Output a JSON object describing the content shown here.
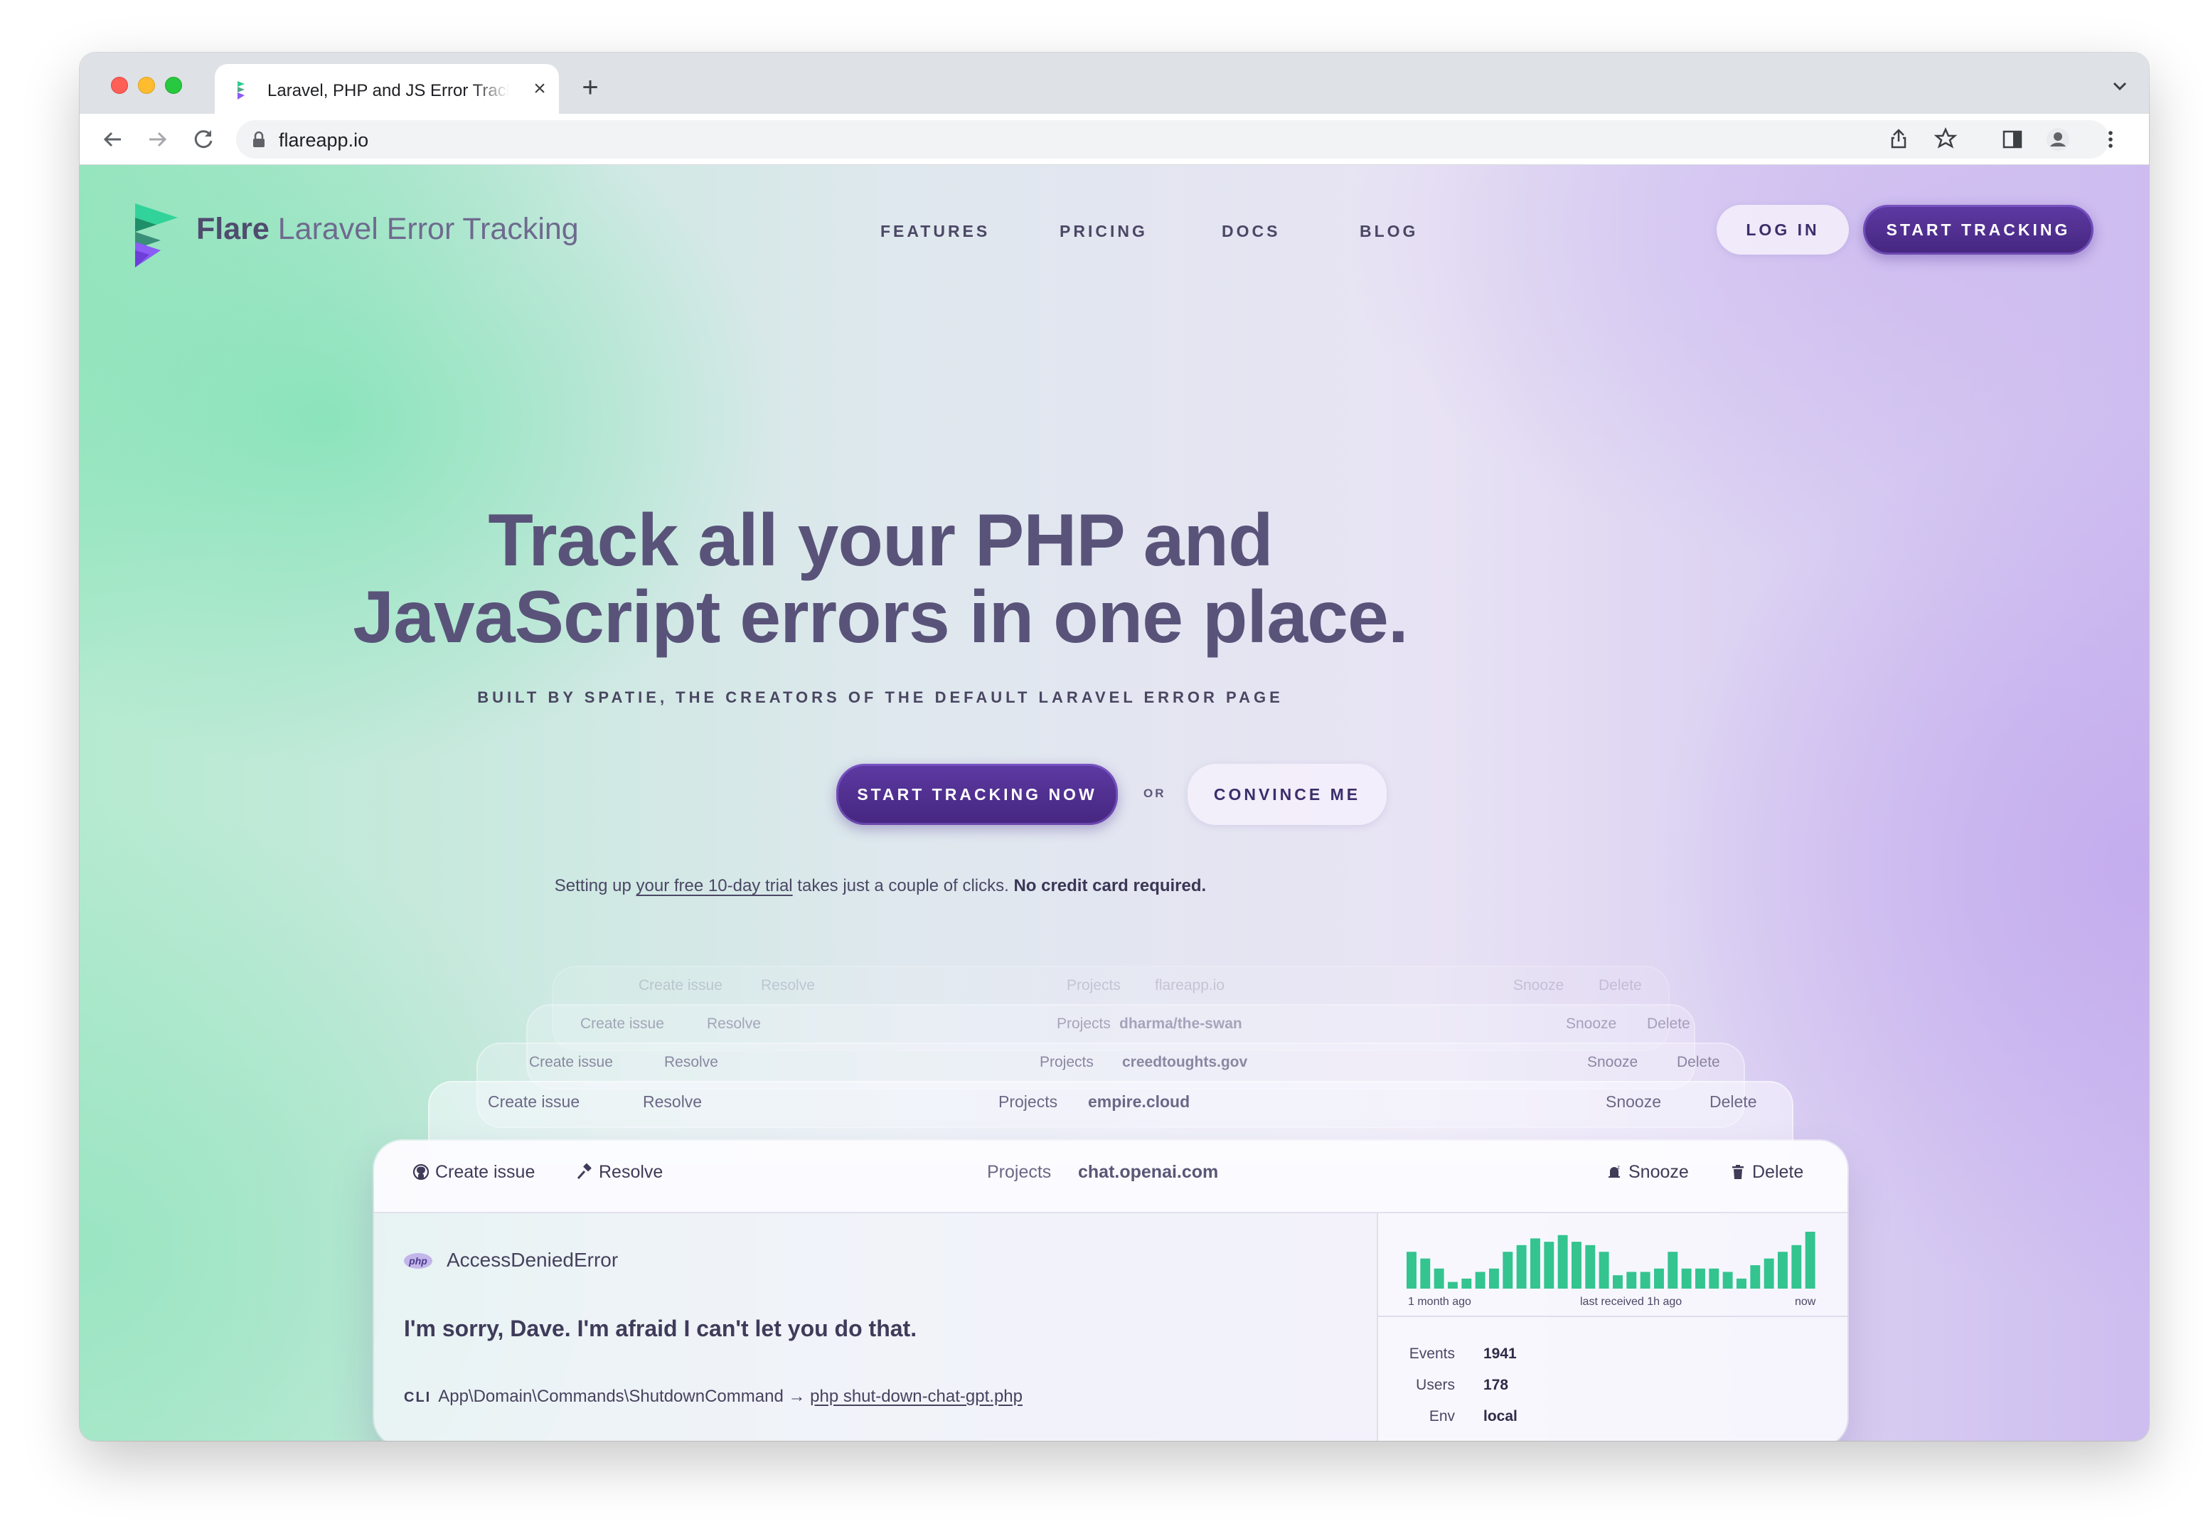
{
  "browser": {
    "tab_title": "Laravel, PHP and JS Error Tracking",
    "url": "flareapp.io",
    "colors": {
      "close_red": "#ff5f57",
      "minimize_yellow": "#febc2e",
      "zoom_green": "#28c840"
    }
  },
  "header": {
    "brand_name": "Flare",
    "brand_tagline": "Laravel Error Tracking",
    "nav": [
      "FEATURES",
      "PRICING",
      "DOCS",
      "BLOG"
    ],
    "login": "LOG IN",
    "start_tracking": "START TRACKING"
  },
  "hero": {
    "title_line1": "Track all your PHP and",
    "title_line2": "JavaScript errors in one place.",
    "subhead": "BUILT BY SPATIE, THE CREATORS OF THE DEFAULT LARAVEL ERROR PAGE",
    "cta_primary": "START TRACKING NOW",
    "or": "OR",
    "cta_secondary": "CONVINCE ME",
    "trial_before": "Setting up ",
    "trial_link": "your free 10-day trial",
    "trial_middle": " takes just a couple of clicks. ",
    "trial_bold": "No credit card required."
  },
  "stack": {
    "create_issue": "Create issue",
    "resolve": "Resolve",
    "projects": "Projects",
    "snooze": "Snooze",
    "delete": "Delete",
    "back_projects": [
      "flareapp.io",
      "dharma/the-swan",
      "creedtoughts.gov",
      "empire.cloud"
    ]
  },
  "card": {
    "project": "chat.openai.com",
    "php_badge": "php",
    "error_class": "AccessDeniedError",
    "error_message": "I'm sorry, Dave. I'm afraid I can't let you do that.",
    "cli_label": "CLI",
    "command": "App\\Domain\\Commands\\ShutdownCommand → ",
    "command_file": "php shut-down-chat-gpt.php",
    "chart_labels": {
      "left": "1 month ago",
      "middle": "last received 1h ago",
      "right": "now"
    },
    "stats": [
      {
        "key": "Events",
        "value": "1941"
      },
      {
        "key": "Users",
        "value": "178"
      },
      {
        "key": "Env",
        "value": "local"
      }
    ]
  },
  "chart_data": {
    "type": "bar",
    "series": [
      {
        "values": [
          22,
          18,
          12,
          4,
          6,
          10,
          12,
          22,
          26,
          30,
          28,
          32,
          28,
          26,
          22,
          8,
          10,
          10,
          12,
          22,
          12,
          12,
          12,
          10,
          6,
          14,
          18,
          22,
          26,
          34
        ]
      }
    ],
    "color": "#34c48f"
  },
  "icons": {
    "tab_favicon": "flare-logo-icon",
    "back": "arrow-left-icon",
    "forward": "arrow-right-icon",
    "reload": "reload-icon",
    "share": "share-icon",
    "bookmark": "star-icon",
    "sidepanel": "side-panel-icon",
    "profile": "profile-avatar-icon",
    "menu": "kebab-menu-icon",
    "github": "github-icon",
    "resolve": "hammer-icon",
    "snooze": "bell-snooze-icon",
    "delete": "trash-icon"
  },
  "colors": {
    "brand_dark": "#4f2d8f",
    "title": "#59537a",
    "mint": "#7ae2b2",
    "lavender": "#c4acee"
  }
}
